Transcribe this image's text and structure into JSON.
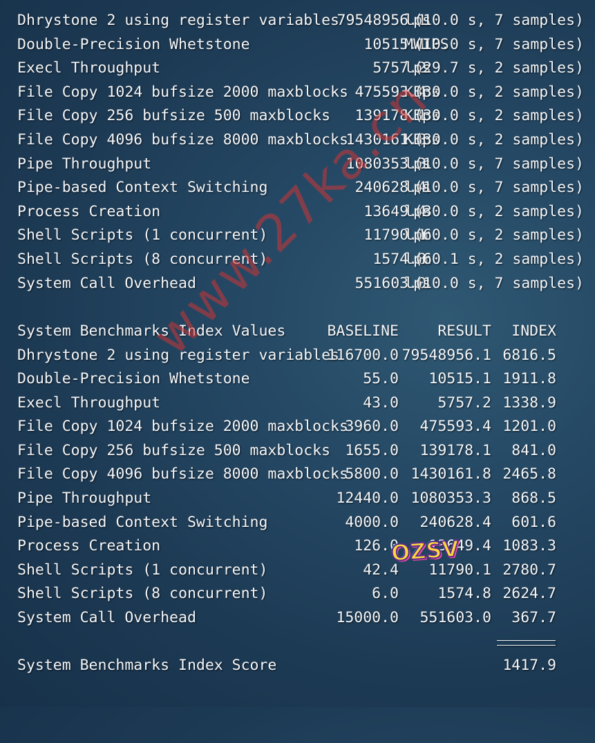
{
  "results": [
    {
      "name": "Dhrystone 2 using register variables",
      "value": "79548956.1",
      "unit": "lps",
      "detail": "(10.0 s, 7 samples)"
    },
    {
      "name": "Double-Precision Whetstone",
      "value": "10515.1",
      "unit": "MWIPS",
      "detail": "(10.0 s, 7 samples)"
    },
    {
      "name": "Execl Throughput",
      "value": "5757.2",
      "unit": "lps",
      "detail": "(29.7 s, 2 samples)"
    },
    {
      "name": "File Copy 1024 bufsize 2000 maxblocks",
      "value": "475593.4",
      "unit": "KBps",
      "detail": "(30.0 s, 2 samples)"
    },
    {
      "name": "File Copy 256 bufsize 500 maxblocks",
      "value": "139178.1",
      "unit": "KBps",
      "detail": "(30.0 s, 2 samples)"
    },
    {
      "name": "File Copy 4096 bufsize 8000 maxblocks",
      "value": "1430161.8",
      "unit": "KBps",
      "detail": "(30.0 s, 2 samples)"
    },
    {
      "name": "Pipe Throughput",
      "value": "1080353.3",
      "unit": "lps",
      "detail": "(10.0 s, 7 samples)"
    },
    {
      "name": "Pipe-based Context Switching",
      "value": "240628.4",
      "unit": "lps",
      "detail": "(10.0 s, 7 samples)"
    },
    {
      "name": "Process Creation",
      "value": "13649.4",
      "unit": "lps",
      "detail": "(30.0 s, 2 samples)"
    },
    {
      "name": "Shell Scripts (1 concurrent)",
      "value": "11790.1",
      "unit": "lpm",
      "detail": "(60.0 s, 2 samples)"
    },
    {
      "name": "Shell Scripts (8 concurrent)",
      "value": "1574.8",
      "unit": "lpm",
      "detail": "(60.1 s, 2 samples)"
    },
    {
      "name": "System Call Overhead",
      "value": "551603.0",
      "unit": "lps",
      "detail": "(10.0 s, 7 samples)"
    }
  ],
  "index_table": {
    "title": "System Benchmarks Index Values",
    "headers": {
      "baseline": "BASELINE",
      "result": "RESULT",
      "index": "INDEX"
    },
    "rows": [
      {
        "name": "Dhrystone 2 using register variables",
        "baseline": "116700.0",
        "result": "79548956.1",
        "index": "6816.5"
      },
      {
        "name": "Double-Precision Whetstone",
        "baseline": "55.0",
        "result": "10515.1",
        "index": "1911.8"
      },
      {
        "name": "Execl Throughput",
        "baseline": "43.0",
        "result": "5757.2",
        "index": "1338.9"
      },
      {
        "name": "File Copy 1024 bufsize 2000 maxblocks",
        "baseline": "3960.0",
        "result": "475593.4",
        "index": "1201.0"
      },
      {
        "name": "File Copy 256 bufsize 500 maxblocks",
        "baseline": "1655.0",
        "result": "139178.1",
        "index": "841.0"
      },
      {
        "name": "File Copy 4096 bufsize 8000 maxblocks",
        "baseline": "5800.0",
        "result": "1430161.8",
        "index": "2465.8"
      },
      {
        "name": "Pipe Throughput",
        "baseline": "12440.0",
        "result": "1080353.3",
        "index": "868.5"
      },
      {
        "name": "Pipe-based Context Switching",
        "baseline": "4000.0",
        "result": "240628.4",
        "index": "601.6"
      },
      {
        "name": "Process Creation",
        "baseline": "126.0",
        "result": "13649.4",
        "index": "1083.3"
      },
      {
        "name": "Shell Scripts (1 concurrent)",
        "baseline": "42.4",
        "result": "11790.1",
        "index": "2780.7"
      },
      {
        "name": "Shell Scripts (8 concurrent)",
        "baseline": "6.0",
        "result": "1574.8",
        "index": "2624.7"
      },
      {
        "name": "System Call Overhead",
        "baseline": "15000.0",
        "result": "551603.0",
        "index": "367.7"
      }
    ],
    "separator": "========"
  },
  "score": {
    "label": "System Benchmarks Index Score",
    "value": "1417.9"
  },
  "watermark": {
    "text": "www.27ka.cn",
    "color": "#cd3434"
  },
  "sticker": {
    "text": "OZSV"
  },
  "colors": {
    "background": "#244763",
    "text": "#f4f6f8"
  }
}
